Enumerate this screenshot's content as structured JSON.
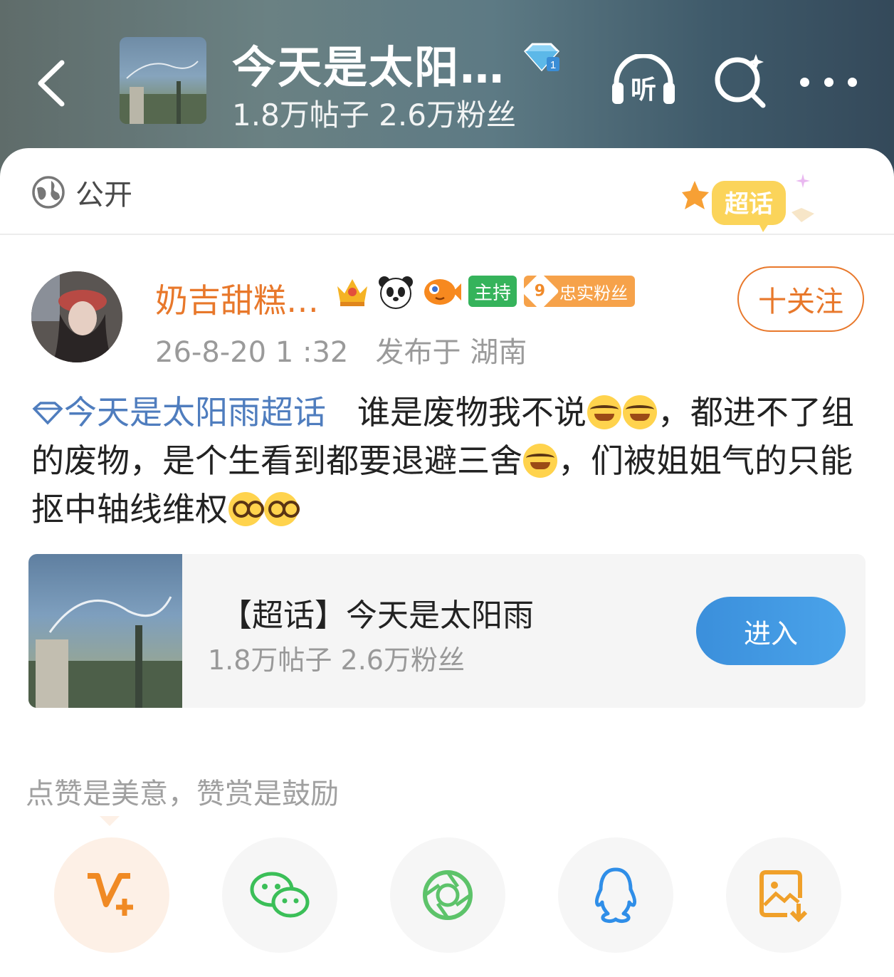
{
  "header": {
    "title": "今天是太阳…",
    "stats": "1.8万帖子 2.6万粉丝",
    "colors": {
      "accent": "#e8782b",
      "link": "#4f7dbe"
    }
  },
  "visibility": {
    "label": "公开"
  },
  "chaohua_badge": "超话",
  "post": {
    "username": "奶吉甜糕…",
    "badges": {
      "host": "主持",
      "fan_level": "9",
      "fan_label": "忠实粉丝"
    },
    "time": "26-8-20 1 :32",
    "location": "发布于 湖南",
    "follow": "十关注",
    "topic_link": "今天是太阳雨超话",
    "text_1": "谁是废物我不说",
    "text_2": "，都进不了组的废物，是个生看到都要退避三舍",
    "text_3": "，们被姐姐气的只能抠中轴线维权"
  },
  "topic_card": {
    "title": "【超话】今天是太阳雨",
    "stats": "1.8万帖子 2.6万粉丝",
    "enter": "进入"
  },
  "reward_hint": "点赞是美意，赞赏是鼓励",
  "share_icons": [
    "v-plus-icon",
    "wechat-icon",
    "moments-icon",
    "qq-icon",
    "save-image-icon"
  ]
}
